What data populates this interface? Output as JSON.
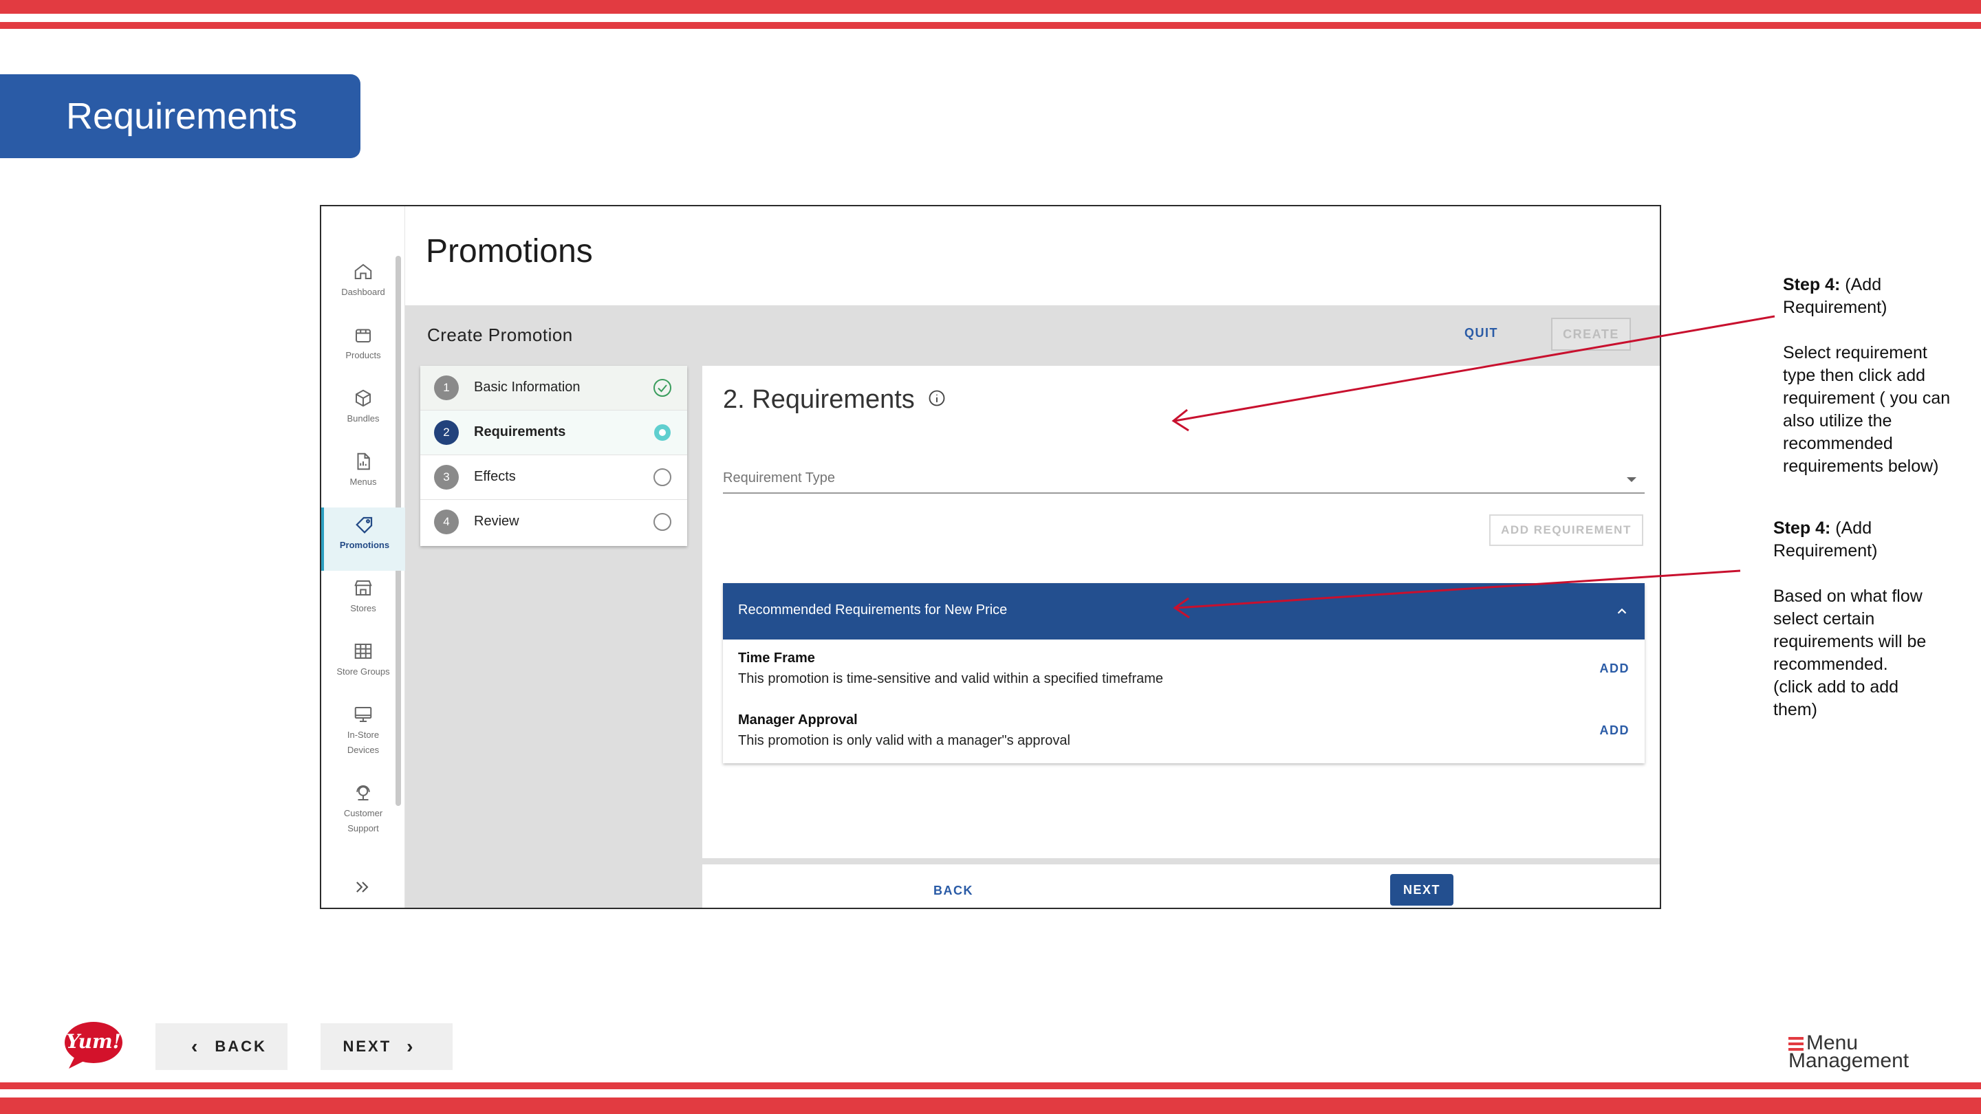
{
  "slide": {
    "title": "Requirements",
    "nav_back": "BACK",
    "nav_next": "NEXT",
    "brand_logo": "Yum!",
    "product_logo_line1": "Menu",
    "product_logo_line2": "Management",
    "stripe_color": "#e23b41",
    "title_bg_color": "#2a5ba6"
  },
  "sidebar": {
    "items": [
      {
        "label": "Dashboard",
        "icon": "home-icon"
      },
      {
        "label": "Products",
        "icon": "box-icon"
      },
      {
        "label": "Bundles",
        "icon": "cube-icon"
      },
      {
        "label": "Menus",
        "icon": "document-icon"
      },
      {
        "label": "Promotions",
        "icon": "tag-icon",
        "active": true
      },
      {
        "label": "Stores",
        "icon": "store-icon"
      },
      {
        "label": "Store Groups",
        "icon": "grid-icon"
      },
      {
        "label": "In-Store Devices",
        "icon": "monitor-icon"
      },
      {
        "label": "Customer Support",
        "icon": "headset-icon"
      }
    ]
  },
  "app": {
    "page_title": "Promotions",
    "section_title": "Create Promotion",
    "quit_label": "QUIT",
    "create_label": "CREATE",
    "steps": [
      {
        "num": "1",
        "label": "Basic Information",
        "state": "done"
      },
      {
        "num": "2",
        "label": "Requirements",
        "state": "current"
      },
      {
        "num": "3",
        "label": "Effects",
        "state": "pending"
      },
      {
        "num": "4",
        "label": "Review",
        "state": "pending"
      }
    ],
    "panel_title": "2. Requirements",
    "requirement_type_label": "Requirement Type",
    "add_requirement_label": "ADD REQUIREMENT",
    "recommended": {
      "header": "Recommended Requirements for New Price",
      "items": [
        {
          "name": "Time Frame",
          "description": "This promotion is time-sensitive and valid within a specified timeframe",
          "action": "ADD"
        },
        {
          "name": "Manager Approval",
          "description": "This promotion is only valid with a manager\"s approval",
          "action": "ADD"
        }
      ]
    },
    "back_label": "BACK",
    "next_label": "NEXT",
    "accent_color": "#234f8f"
  },
  "annotations": [
    {
      "heading": "Step 4:",
      "heading_rest": " (Add",
      "lines": [
        "Requirement)",
        "",
        "Select requirement",
        "type then click add",
        "requirement ( you can",
        "also utilize the",
        "recommended",
        "requirements below)"
      ]
    },
    {
      "heading": "Step 4:",
      "heading_rest": " (Add",
      "lines": [
        "Requirement)",
        "",
        "Based on what flow",
        "select certain",
        "requirements will be",
        "recommended.",
        "(click add to add",
        "them)"
      ]
    }
  ]
}
